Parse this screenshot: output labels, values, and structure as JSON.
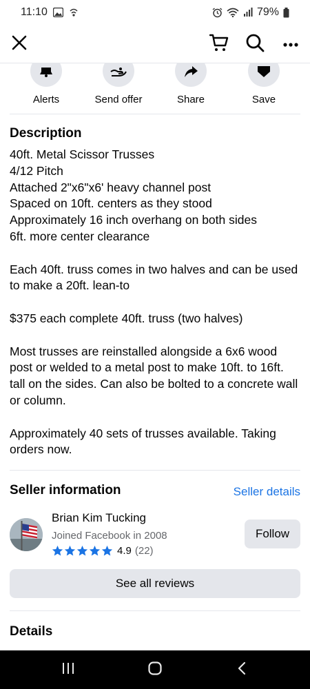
{
  "status_bar": {
    "time": "11:10",
    "battery": "79%"
  },
  "top_bar": {
    "icons": [
      "close-icon",
      "cart-icon",
      "search-icon",
      "more-icon"
    ]
  },
  "actions": [
    {
      "label": "Alerts",
      "icon": "bell-icon"
    },
    {
      "label": "Send offer",
      "icon": "send-offer-icon"
    },
    {
      "label": "Share",
      "icon": "share-icon"
    },
    {
      "label": "Save",
      "icon": "bookmark-icon"
    }
  ],
  "description": {
    "title": "Description",
    "paragraphs": [
      "40ft. Metal Scissor Trusses\n4/12 Pitch\nAttached 2\"x6\"x6' heavy channel post\nSpaced on 10ft. centers as they stood\nApproximately 16 inch overhang on both sides\n6ft. more center clearance",
      "Each 40ft. truss comes in two halves and can be used to make a 20ft. lean-to",
      "$375 each complete 40ft. truss (two halves)",
      "Most trusses are reinstalled alongside a 6x6 wood post or welded to a metal post to make 10ft. to 16ft. tall on the sides.  Can also be bolted to a concrete wall or column.",
      "Approximately 40 sets of trusses available.  Taking orders now."
    ]
  },
  "seller": {
    "section_title": "Seller information",
    "details_link": "Seller details",
    "name": "Brian Kim Tucking",
    "joined": "Joined Facebook in 2008",
    "rating": "4.9",
    "rating_count": "(22)",
    "stars": 5,
    "follow_label": "Follow",
    "reviews_label": "See all reviews"
  },
  "details": {
    "title": "Details"
  },
  "colors": {
    "accent": "#1b74e4",
    "button_bg": "#e4e6eb",
    "secondary_text": "#65676b"
  }
}
